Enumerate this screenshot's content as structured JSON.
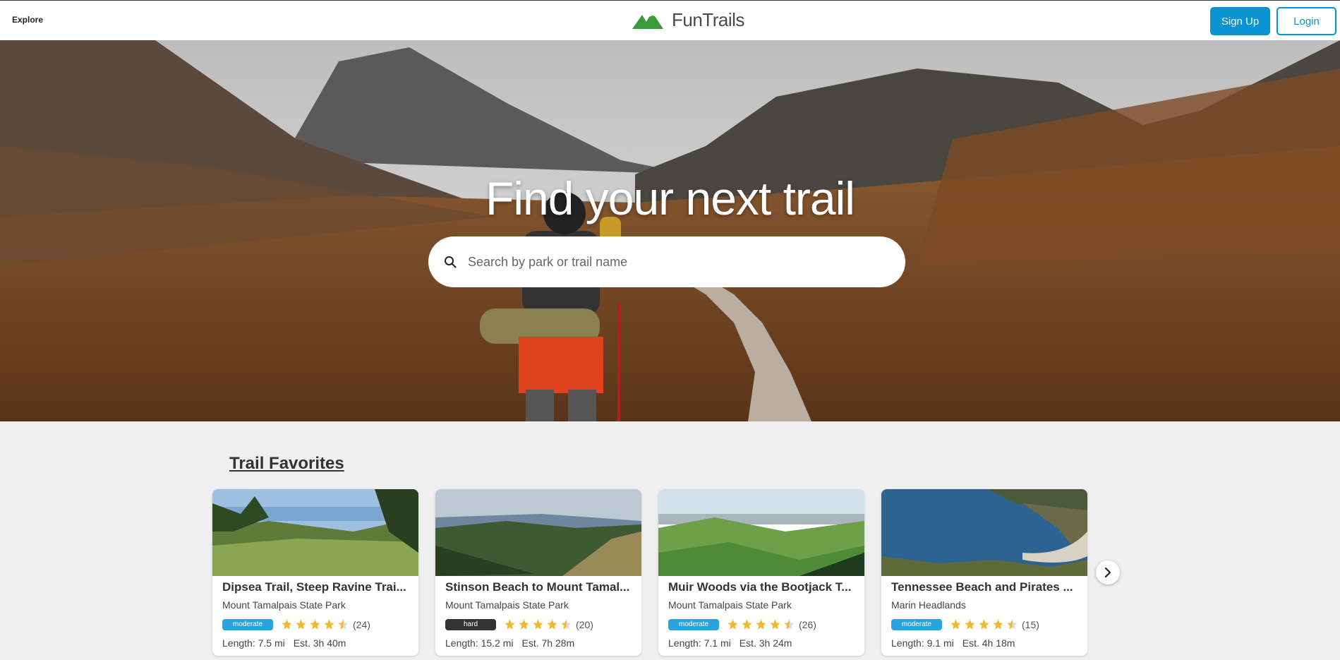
{
  "header": {
    "explore": "Explore",
    "brand": "FunTrails",
    "signup": "Sign Up",
    "login": "Login"
  },
  "hero": {
    "title": "Find your next trail",
    "search_placeholder": "Search by park or trail name"
  },
  "favorites": {
    "title": "Trail Favorites",
    "cards": [
      {
        "name": "Dipsea Trail, Steep Ravine Trai...",
        "park": "Mount Tamalpais State Park",
        "difficulty": "moderate",
        "rating": 4.5,
        "reviews": "(24)",
        "length": "Length: 7.5 mi",
        "est": "Est. 3h 40m"
      },
      {
        "name": "Stinson Beach to Mount Tamal...",
        "park": "Mount Tamalpais State Park",
        "difficulty": "hard",
        "rating": 4.5,
        "reviews": "(20)",
        "length": "Length: 15.2 mi",
        "est": "Est. 7h 28m"
      },
      {
        "name": "Muir Woods via the Bootjack T...",
        "park": "Mount Tamalpais State Park",
        "difficulty": "moderate",
        "rating": 4.5,
        "reviews": "(26)",
        "length": "Length: 7.1 mi",
        "est": "Est. 3h 24m"
      },
      {
        "name": "Tennessee Beach and Pirates ...",
        "park": "Marin Headlands",
        "difficulty": "moderate",
        "rating": 4.5,
        "reviews": "(15)",
        "length": "Length: 9.1 mi",
        "est": "Est. 4h 18m"
      }
    ]
  },
  "colors": {
    "accent": "#0a93d3",
    "moderate": "#2aa3dc",
    "hard": "#333333",
    "star": "#f5b72a",
    "logo_green": "#3a9a3a"
  },
  "icons": {
    "search": "search-icon",
    "next": "chevron-right-icon",
    "logo": "mountains-logo-icon"
  }
}
